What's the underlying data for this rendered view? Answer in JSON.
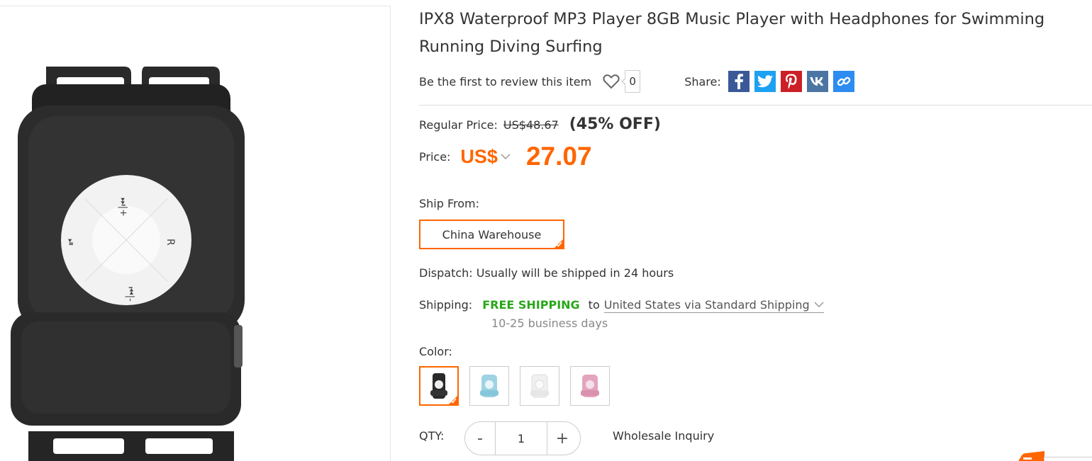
{
  "product": {
    "title": "IPX8 Waterproof MP3 Player 8GB Music Player with Headphones for Swimming Running Diving Surfing",
    "image_alt": "black waterproof MP3 player",
    "image_buttons": {
      "top": "⏭|+",
      "left": "⏯",
      "right": "R",
      "bottom": "⏮|-"
    }
  },
  "review": {
    "link_text": "Be the first to review this item",
    "favorite_count": "0",
    "share_label": "Share:",
    "share_icons": [
      "facebook-icon",
      "twitter-icon",
      "pinterest-icon",
      "vk-icon",
      "link-icon"
    ]
  },
  "pricing": {
    "regular_label": "Regular Price:",
    "regular_value": "US$48.67",
    "discount": "(45% OFF)",
    "price_label": "Price:",
    "currency": "US$",
    "price": "27.07"
  },
  "ship_from": {
    "label": "Ship From:",
    "option": "China Warehouse"
  },
  "dispatch": {
    "text": "Dispatch: Usually will be shipped in 24 hours"
  },
  "shipping": {
    "label": "Shipping:",
    "free": "FREE SHIPPING",
    "to": "to",
    "method": "United States via Standard Shipping",
    "days": "10-25 business days"
  },
  "color": {
    "label": "Color:",
    "options": [
      "black",
      "light-blue",
      "white",
      "pink"
    ],
    "selected": "black"
  },
  "qty": {
    "label": "QTY:",
    "minus": "-",
    "value": "1",
    "plus": "+",
    "wholesale": "Wholesale Inquiry"
  },
  "colors": {
    "accent": "#ff6600",
    "free_shipping": "#29a71a",
    "facebook": "#3b5998",
    "twitter": "#1da1f2",
    "pinterest": "#cb2027",
    "vk": "#4c75a3",
    "link": "#2d8cf0"
  }
}
